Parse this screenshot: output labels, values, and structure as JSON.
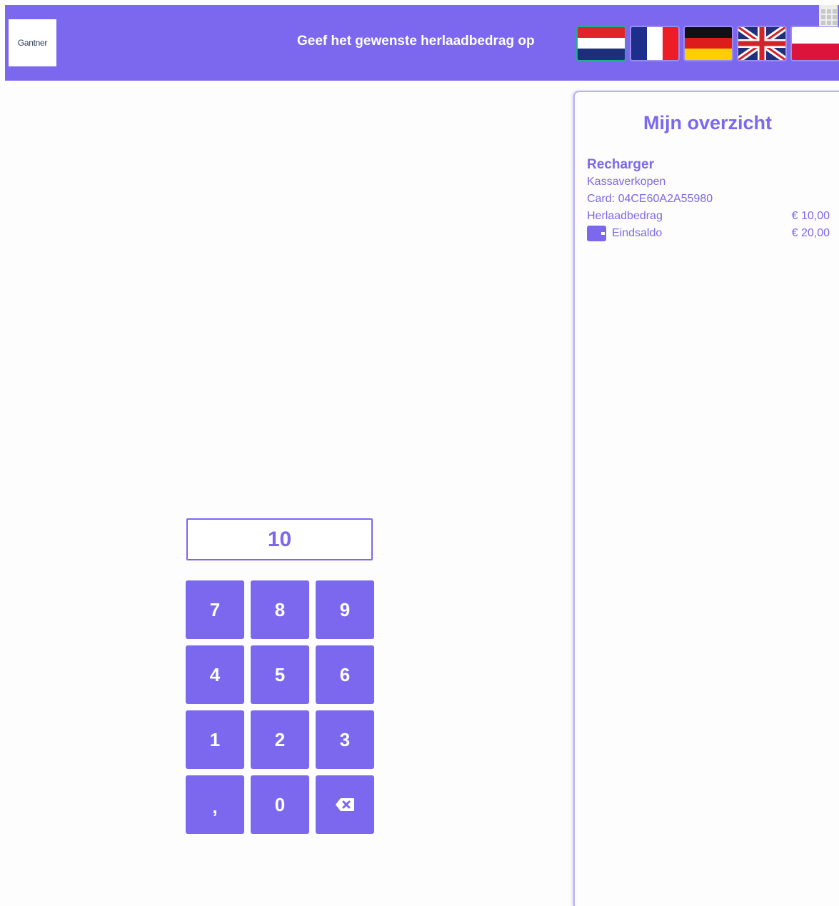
{
  "header": {
    "logo_text": "Gantner",
    "title": "Geef het gewenste herlaadbedrag op",
    "languages": [
      {
        "code": "nl",
        "icon": "flag-netherlands-icon",
        "selected": true
      },
      {
        "code": "fr",
        "icon": "flag-france-icon",
        "selected": false
      },
      {
        "code": "de",
        "icon": "flag-germany-icon",
        "selected": false
      },
      {
        "code": "en",
        "icon": "flag-united-kingdom-icon",
        "selected": false
      },
      {
        "code": "pl",
        "icon": "flag-poland-icon",
        "selected": false
      }
    ],
    "grip_icon": "grid-handle-icon"
  },
  "overview": {
    "title": "Mijn overzicht",
    "heading": "Recharger",
    "subtitle": "Kassaverkopen",
    "card_line": "Card: 04CE60A2A55980",
    "reload_label": "Herlaadbedrag",
    "reload_value": "€ 10,00",
    "balance_icon": "wallet-icon",
    "balance_label": "Eindsaldo",
    "balance_value": "€ 20,00"
  },
  "amount": {
    "value": "10"
  },
  "keypad": {
    "keys": [
      "7",
      "8",
      "9",
      "4",
      "5",
      "6",
      "1",
      "2",
      "3",
      ",",
      "0"
    ],
    "backspace_icon": "backspace-icon"
  },
  "colors": {
    "accent": "#7b68ee",
    "selected_flag_border": "#1fb08a",
    "background": "#fdfdfd"
  }
}
